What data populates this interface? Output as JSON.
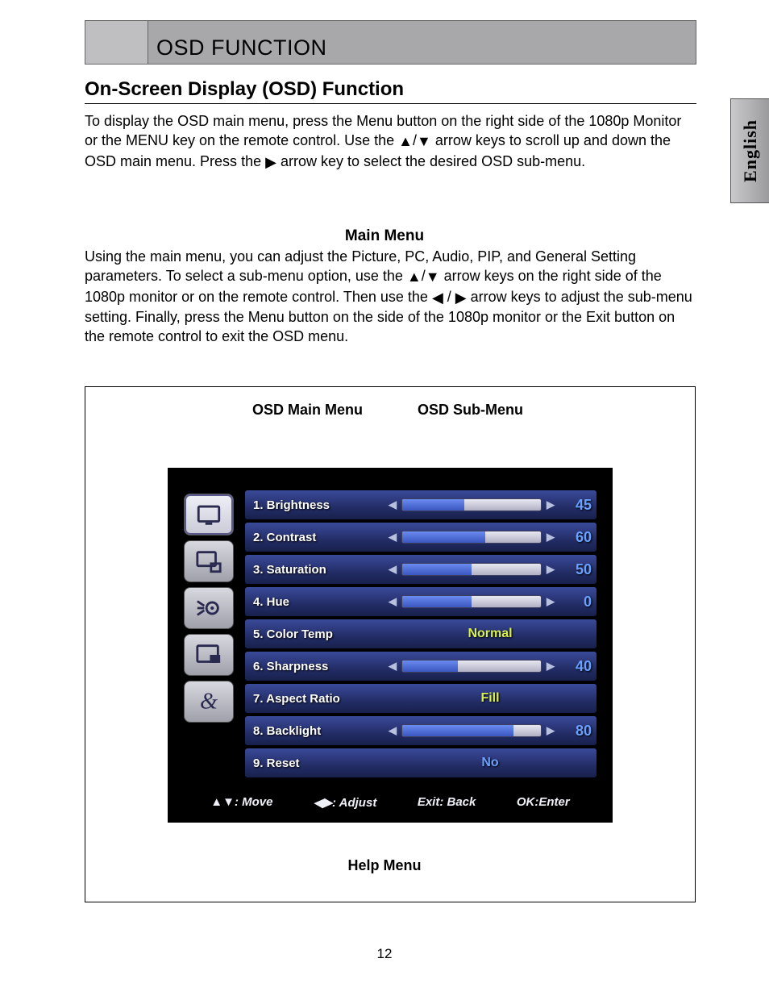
{
  "header": {
    "title": "OSD FUNCTION"
  },
  "section_title": "On-Screen Display (OSD) Function",
  "intro_parts": {
    "p1a": "To display the OSD main menu, press the Menu button on the right side of the 1080p Monitor or the MENU key on the remote control. Use the ",
    "p1b": " arrow keys to scroll up and down the OSD main menu.   Press the ",
    "p1c": " arrow key to select the desired OSD sub-menu."
  },
  "main_menu_title": "Main Menu",
  "main_menu_parts": {
    "a": "Using the main menu, you can adjust the Picture, PC, Audio, PIP, and General Setting parameters. To select a sub-menu option, use the ",
    "b": "arrow keys on the right side of the 1080p monitor or on the remote control.   Then use the ",
    "c": " arrow keys to adjust the sub-menu setting.   Finally, press the Menu button on the side of the 1080p monitor or the Exit button on the remote control to exit the OSD menu."
  },
  "side_tab": "English",
  "figure": {
    "label_main": "OSD Main Menu",
    "label_sub": "OSD Sub-Menu",
    "label_help": "Help Menu"
  },
  "osd": {
    "items": [
      {
        "label": "1. Brightness",
        "type": "slider",
        "value": 45,
        "max": 100
      },
      {
        "label": "2. Contrast",
        "type": "slider",
        "value": 60,
        "max": 100
      },
      {
        "label": "3. Saturation",
        "type": "slider",
        "value": 50,
        "max": 100
      },
      {
        "label": "4. Hue",
        "type": "slider",
        "value": 0,
        "max": 100,
        "fill": 50
      },
      {
        "label": "5. Color Temp",
        "type": "text",
        "text": "Normal",
        "color": "yellow"
      },
      {
        "label": "6. Sharpness",
        "type": "slider",
        "value": 40,
        "max": 100
      },
      {
        "label": "7. Aspect Ratio",
        "type": "text",
        "text": "Fill",
        "color": "yellow"
      },
      {
        "label": "8. Backlight",
        "type": "slider",
        "value": 80,
        "max": 100
      },
      {
        "label": "9. Reset",
        "type": "text",
        "text": "No",
        "color": "blue"
      }
    ],
    "help": {
      "move": "▲▼: Move",
      "adjust": "◀▶: Adjust",
      "back": "Exit: Back",
      "enter": "OK:Enter"
    }
  },
  "page_number": "12"
}
